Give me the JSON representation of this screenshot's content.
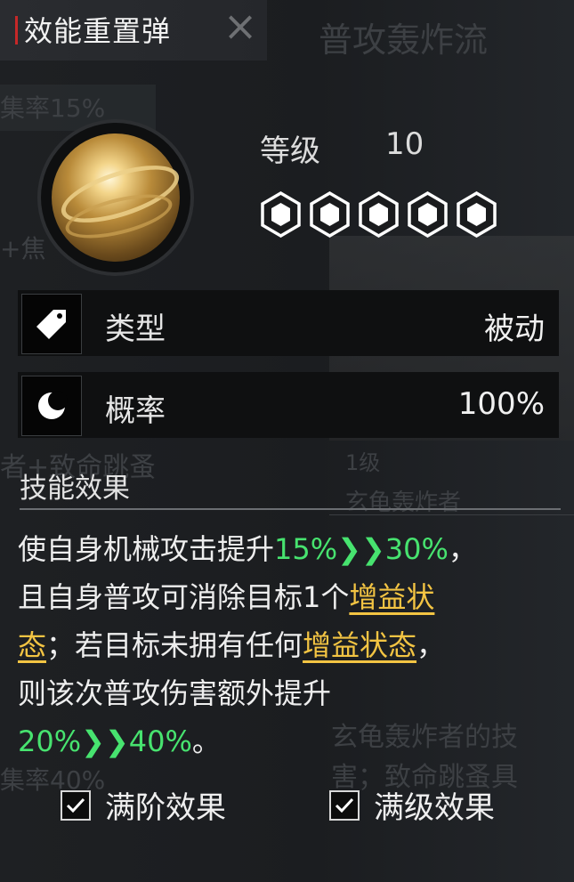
{
  "title": "效能重置弹",
  "level": {
    "label": "等级",
    "value": "10",
    "stars_filled": 5,
    "stars_total": 5
  },
  "rows": [
    {
      "icon": "tag-icon",
      "label": "类型",
      "value": "被动"
    },
    {
      "icon": "moon-icon",
      "label": "概率",
      "value": "100%"
    }
  ],
  "section_title": "技能效果",
  "description": {
    "p1": "使自身机械攻击提升",
    "p1_from": "15%",
    "p1_to": "30%",
    "p1_end": "，",
    "p2": "且自身普攻可消除目标1个",
    "p2_link": "增益状",
    "p3_link": "态",
    "p3": "；若目标未拥有任何",
    "p3_link2": "增益状态",
    "p3_end": "，",
    "p4": "则该次普攻伤害额外提升",
    "p5_from": "20%",
    "p5_to": "40%",
    "p5_end": "。"
  },
  "checkboxes": [
    {
      "label": "满阶效果",
      "checked": true
    },
    {
      "label": "满级效果",
      "checked": true
    }
  ],
  "background": {
    "t1": "普攻轰炸流",
    "t2": "集率15%",
    "t3": "者+致命跳蚤",
    "t4": "1级",
    "t5": "玄龟轰炸者",
    "t6": "玄龟轰炸者的技",
    "t7": "害；致命跳蚤具",
    "t8": "集率40%",
    "t9": "+焦"
  },
  "colors": {
    "accent_red": "#c62828",
    "green": "#47e36f",
    "gold": "#f3c443"
  }
}
